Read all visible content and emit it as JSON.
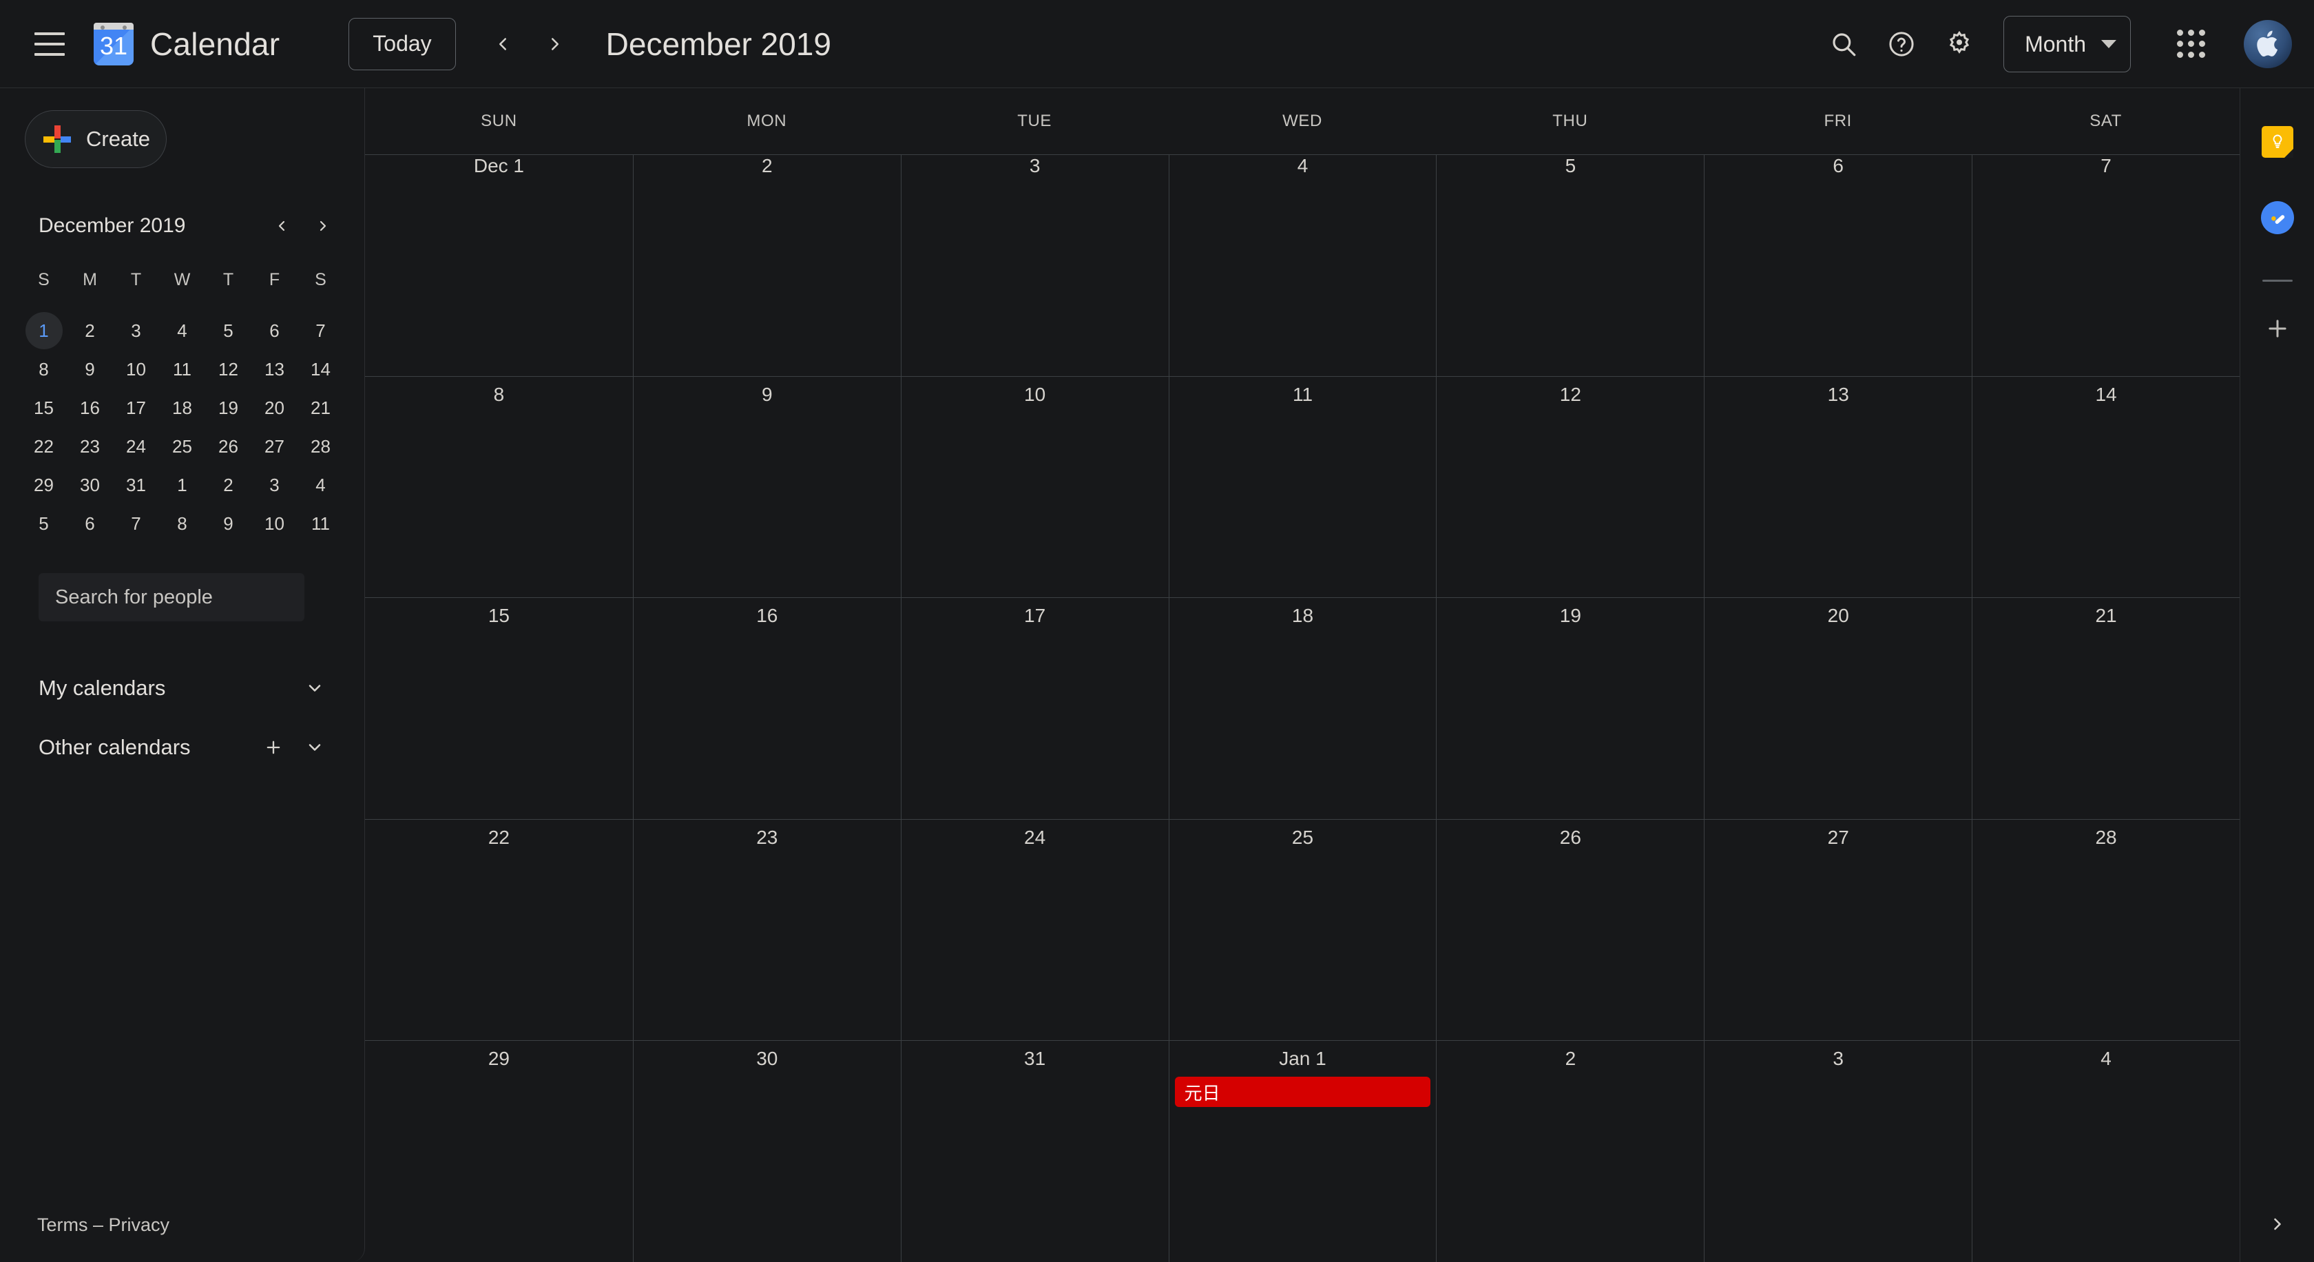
{
  "app": {
    "brand_name": "Calendar",
    "logo_day": "31"
  },
  "topbar": {
    "menu_icon": "hamburger-menu-icon",
    "today_label": "Today",
    "prev_icon": "chevron-left-icon",
    "next_icon": "chevron-right-icon",
    "period_title": "December 2019",
    "search_icon": "search-icon",
    "help_icon": "help-circle-icon",
    "settings_icon": "gear-icon",
    "view_label": "Month",
    "view_caret_icon": "chevron-down-icon",
    "apps_icon": "apps-grid-icon",
    "avatar_icon": "apple-logo-avatar"
  },
  "sidebar": {
    "create_label": "Create",
    "create_icon": "plus-multicolor-icon",
    "mini_calendar": {
      "title": "December 2019",
      "prev_icon": "chevron-left-icon",
      "next_icon": "chevron-right-icon",
      "dow": [
        "S",
        "M",
        "T",
        "W",
        "T",
        "F",
        "S"
      ],
      "weeks": [
        [
          {
            "d": "1",
            "today": true
          },
          {
            "d": "2"
          },
          {
            "d": "3"
          },
          {
            "d": "4"
          },
          {
            "d": "5"
          },
          {
            "d": "6"
          },
          {
            "d": "7"
          }
        ],
        [
          {
            "d": "8"
          },
          {
            "d": "9"
          },
          {
            "d": "10"
          },
          {
            "d": "11"
          },
          {
            "d": "12"
          },
          {
            "d": "13"
          },
          {
            "d": "14"
          }
        ],
        [
          {
            "d": "15"
          },
          {
            "d": "16"
          },
          {
            "d": "17"
          },
          {
            "d": "18"
          },
          {
            "d": "19"
          },
          {
            "d": "20"
          },
          {
            "d": "21"
          }
        ],
        [
          {
            "d": "22"
          },
          {
            "d": "23"
          },
          {
            "d": "24"
          },
          {
            "d": "25"
          },
          {
            "d": "26"
          },
          {
            "d": "27"
          },
          {
            "d": "28"
          }
        ],
        [
          {
            "d": "29"
          },
          {
            "d": "30"
          },
          {
            "d": "31"
          },
          {
            "d": "1"
          },
          {
            "d": "2"
          },
          {
            "d": "3"
          },
          {
            "d": "4"
          }
        ],
        [
          {
            "d": "5"
          },
          {
            "d": "6"
          },
          {
            "d": "7"
          },
          {
            "d": "8"
          },
          {
            "d": "9"
          },
          {
            "d": "10"
          },
          {
            "d": "11"
          }
        ]
      ]
    },
    "people_search_placeholder": "Search for people",
    "people_search_value": "",
    "sections": [
      {
        "title": "My calendars",
        "has_add": false,
        "collapse_icon": "chevron-down-icon"
      },
      {
        "title": "Other calendars",
        "has_add": true,
        "add_icon": "plus-icon",
        "collapse_icon": "chevron-down-icon"
      }
    ],
    "footer": "Terms – Privacy"
  },
  "calendar": {
    "dow_headers": [
      "SUN",
      "MON",
      "TUE",
      "WED",
      "THU",
      "FRI",
      "SAT"
    ],
    "weeks": [
      [
        {
          "label": "Dec 1",
          "events": []
        },
        {
          "label": "2",
          "events": []
        },
        {
          "label": "3",
          "events": []
        },
        {
          "label": "4",
          "events": []
        },
        {
          "label": "5",
          "events": []
        },
        {
          "label": "6",
          "events": []
        },
        {
          "label": "7",
          "events": []
        }
      ],
      [
        {
          "label": "8",
          "events": []
        },
        {
          "label": "9",
          "events": []
        },
        {
          "label": "10",
          "events": []
        },
        {
          "label": "11",
          "events": []
        },
        {
          "label": "12",
          "events": []
        },
        {
          "label": "13",
          "events": []
        },
        {
          "label": "14",
          "events": []
        }
      ],
      [
        {
          "label": "15",
          "events": []
        },
        {
          "label": "16",
          "events": []
        },
        {
          "label": "17",
          "events": []
        },
        {
          "label": "18",
          "events": []
        },
        {
          "label": "19",
          "events": []
        },
        {
          "label": "20",
          "events": []
        },
        {
          "label": "21",
          "events": []
        }
      ],
      [
        {
          "label": "22",
          "events": []
        },
        {
          "label": "23",
          "events": []
        },
        {
          "label": "24",
          "events": []
        },
        {
          "label": "25",
          "events": []
        },
        {
          "label": "26",
          "events": []
        },
        {
          "label": "27",
          "events": []
        },
        {
          "label": "28",
          "events": []
        }
      ],
      [
        {
          "label": "29",
          "events": []
        },
        {
          "label": "30",
          "events": []
        },
        {
          "label": "31",
          "events": []
        },
        {
          "label": "Jan 1",
          "events": [
            {
              "title": "元日",
              "color": "#d50000"
            }
          ]
        },
        {
          "label": "2",
          "events": []
        },
        {
          "label": "3",
          "events": []
        },
        {
          "label": "4",
          "events": []
        }
      ]
    ]
  },
  "right_rail": {
    "items": [
      {
        "icon": "google-keep-icon",
        "color": "#fbbc04"
      },
      {
        "icon": "google-tasks-icon",
        "color": "#4285f4"
      }
    ],
    "add_icon": "plus-icon",
    "expand_icon": "chevron-right-icon"
  },
  "colors": {
    "background": "#17181a",
    "grid_line": "#3c4043",
    "text_primary": "#e3e0dc",
    "text_secondary": "#c8c6c2",
    "accent_blue": "#5b9bf8",
    "event_red": "#d50000"
  }
}
